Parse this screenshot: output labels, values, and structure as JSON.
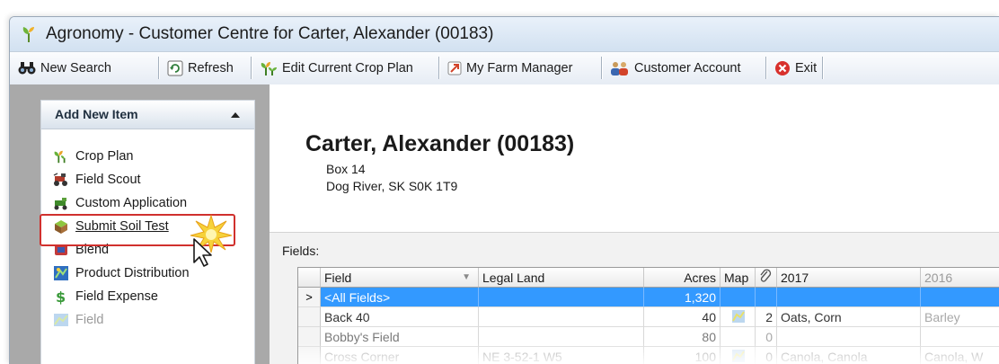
{
  "window": {
    "title": "Agronomy - Customer Centre for Carter, Alexander (00183)"
  },
  "toolbar": {
    "new_search": "New Search",
    "refresh": "Refresh",
    "edit_crop_plan": "Edit Current Crop Plan",
    "my_farm_manager": "My Farm Manager",
    "customer_account": "Customer Account",
    "exit": "Exit"
  },
  "sidebar": {
    "header": "Add New Item",
    "items": [
      {
        "label": "Crop Plan",
        "icon": "crop-plan-icon"
      },
      {
        "label": "Field Scout",
        "icon": "field-scout-icon"
      },
      {
        "label": "Custom Application",
        "icon": "custom-application-icon"
      },
      {
        "label": "Submit Soil Test",
        "icon": "soil-test-icon"
      },
      {
        "label": "Blend",
        "icon": "blend-icon"
      },
      {
        "label": "Product Distribution",
        "icon": "product-distribution-icon"
      },
      {
        "label": "Field Expense",
        "icon": "field-expense-icon"
      },
      {
        "label": "Field",
        "icon": "field-icon"
      }
    ]
  },
  "customer": {
    "name": "Carter, Alexander (00183)",
    "address_line1": "Box 14",
    "address_line2": "Dog River, SK  S0K 1T9"
  },
  "fields_grid": {
    "label": "Fields:",
    "columns": [
      "Field",
      "Legal Land",
      "Acres",
      "Map",
      "2017",
      "2016"
    ],
    "rows": [
      {
        "indicator": ">",
        "field": "<All Fields>",
        "legal": "",
        "acres": "1,320",
        "map": false,
        "att": "",
        "y2017": "",
        "y2016": ""
      },
      {
        "indicator": "",
        "field": "Back 40",
        "legal": "",
        "acres": "40",
        "map": true,
        "att": "2",
        "y2017": "Oats, Corn",
        "y2016": "Barley"
      },
      {
        "indicator": "",
        "field": "Bobby's Field",
        "legal": "",
        "acres": "80",
        "map": false,
        "att": "0",
        "y2017": "",
        "y2016": ""
      },
      {
        "indicator": "",
        "field": "Cross Corner",
        "legal": "NE 3-52-1 W5",
        "acres": "100",
        "map": true,
        "att": "0",
        "y2017": "Canola, Canola",
        "y2016": "Canola, W"
      }
    ]
  },
  "colors": {
    "selection": "#3399ff",
    "highlight_box": "#d0302d",
    "side_background": "#a9a9a9"
  }
}
